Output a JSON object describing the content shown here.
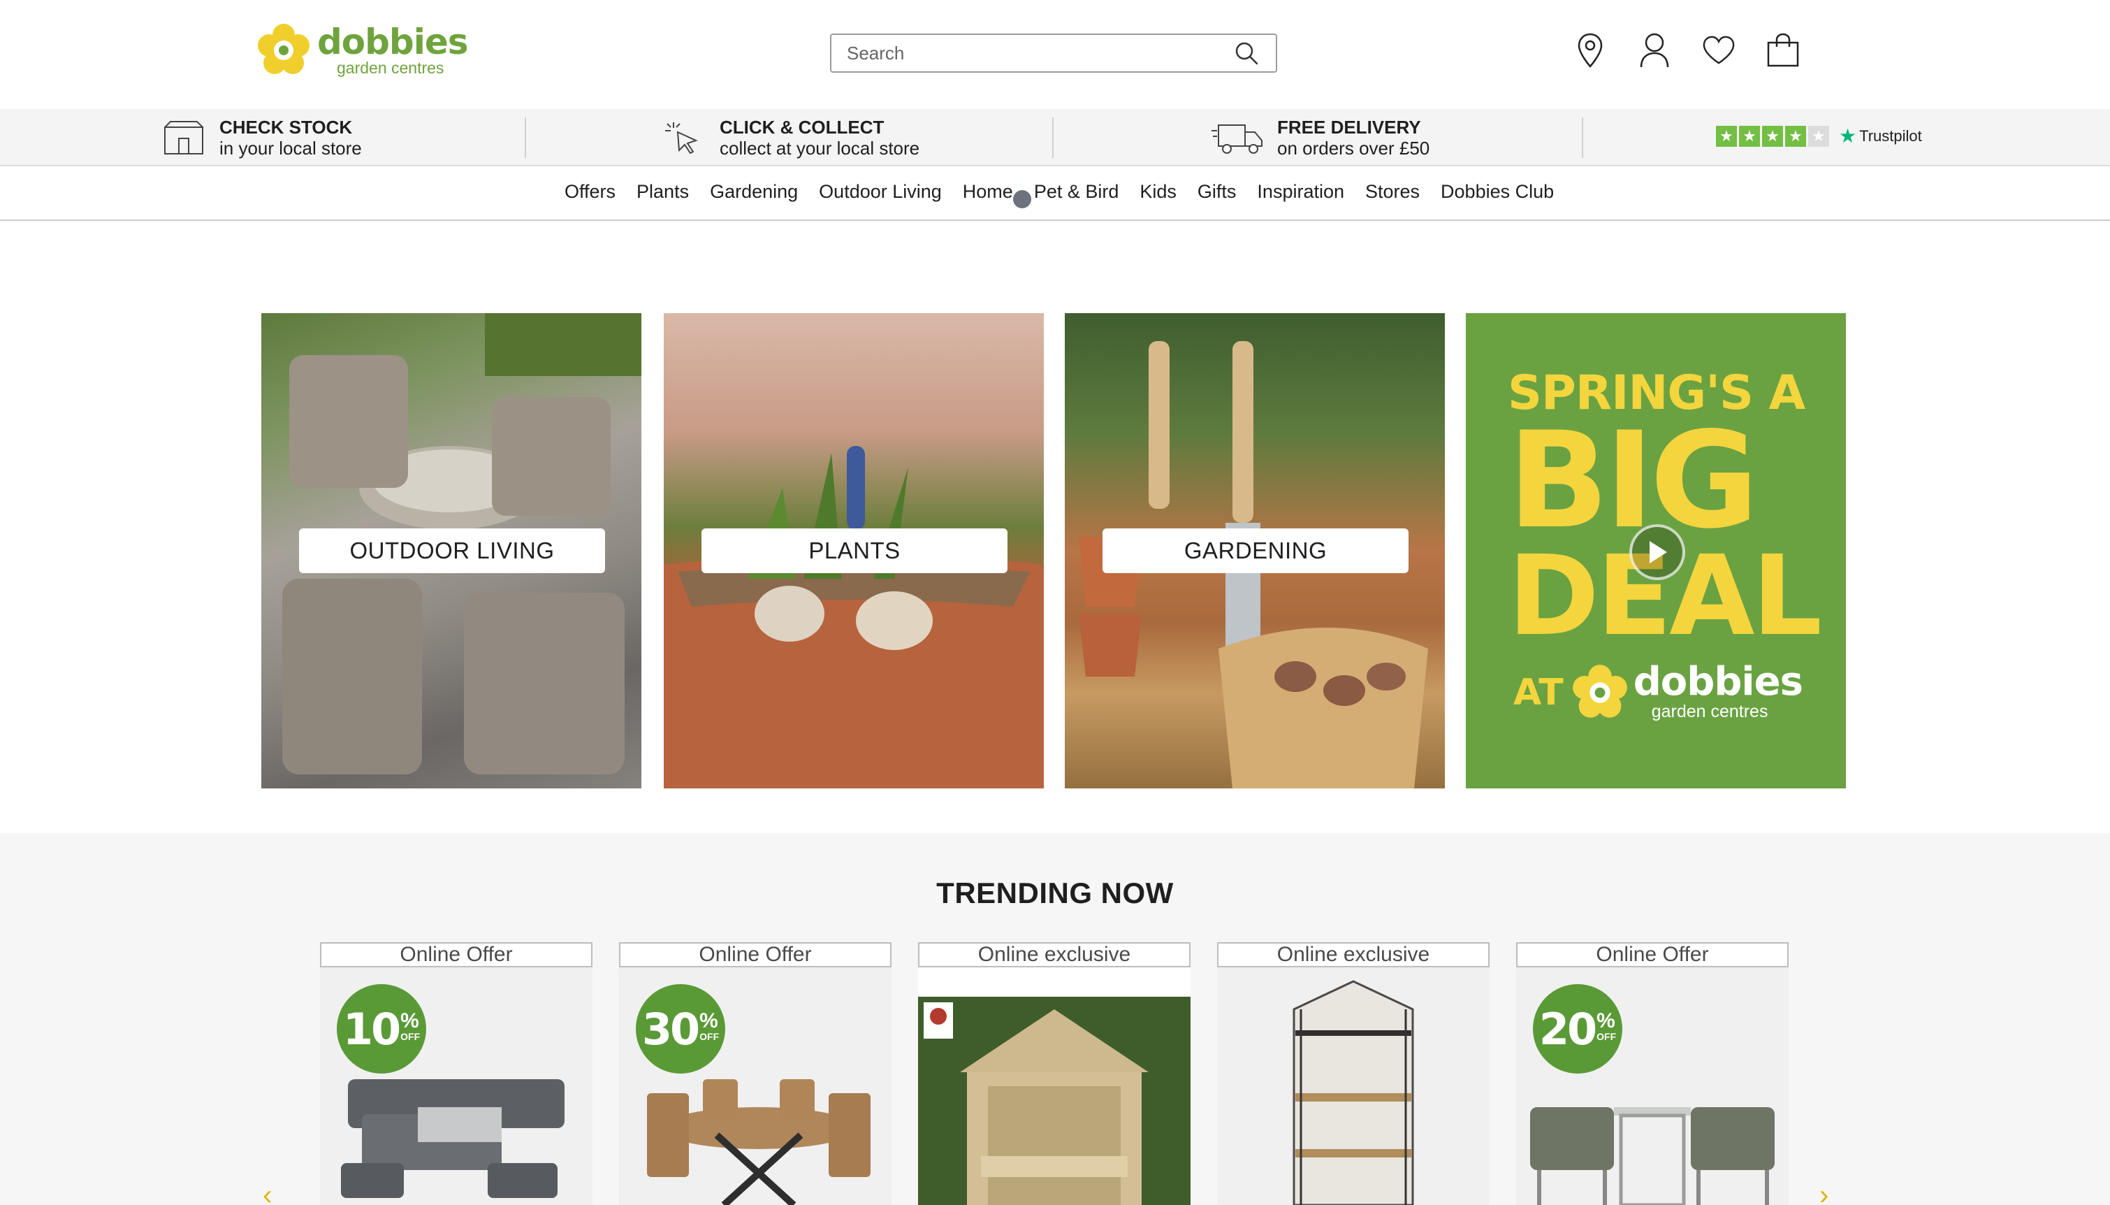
{
  "header": {
    "logo": {
      "word": "dobbies",
      "sub": "garden centres"
    },
    "search": {
      "placeholder": "Search"
    },
    "icons": [
      "location-pin-icon",
      "account-icon",
      "wishlist-heart-icon",
      "basket-bag-icon"
    ]
  },
  "usp": [
    {
      "icon": "store-icon",
      "title": "CHECK STOCK",
      "subtitle": "in your local store"
    },
    {
      "icon": "click-cursor-icon",
      "title": "CLICK & COLLECT",
      "subtitle": "collect at your local store"
    },
    {
      "icon": "delivery-truck-icon",
      "title": "FREE DELIVERY",
      "subtitle": "on orders over £50"
    }
  ],
  "trustpilot": {
    "label": "Trustpilot",
    "rating_stars": 4.5,
    "color": "#73bf43"
  },
  "nav": [
    "Offers",
    "Plants",
    "Gardening",
    "Outdoor Living",
    "Home",
    "Pet & Bird",
    "Kids",
    "Gifts",
    "Inspiration",
    "Stores",
    "Dobbies Club"
  ],
  "categories": [
    {
      "label": "OUTDOOR LIVING"
    },
    {
      "label": "PLANTS"
    },
    {
      "label": "GARDENING"
    }
  ],
  "promo": {
    "line1": "SPRING'S A",
    "line2": "BIG",
    "line3": "DEAL",
    "at": "AT",
    "brand_word": "dobbies",
    "brand_sub": "garden centres",
    "bg_color": "#6aa242",
    "text_color": "#f4d53e"
  },
  "trending": {
    "title": "TRENDING NOW",
    "products": [
      {
        "badge": "Online Offer",
        "discount": "10",
        "discount_pct": "%",
        "discount_off": "OFF",
        "image": "corner-sofa-firepit-set"
      },
      {
        "badge": "Online Offer",
        "discount": "30",
        "discount_pct": "%",
        "discount_off": "OFF",
        "image": "round-wooden-dining-set"
      },
      {
        "badge": "Online exclusive",
        "discount": "",
        "image": "wooden-arbour-bench"
      },
      {
        "badge": "Online exclusive",
        "discount": "",
        "image": "mini-greenhouse"
      },
      {
        "badge": "Online Offer",
        "discount": "20",
        "discount_pct": "%",
        "discount_off": "OFF",
        "image": "grey-companion-seat"
      }
    ]
  },
  "colors": {
    "brand_green": "#6fa33d",
    "discount_green": "#5a9a36",
    "accent_yellow": "#f4d53e"
  }
}
